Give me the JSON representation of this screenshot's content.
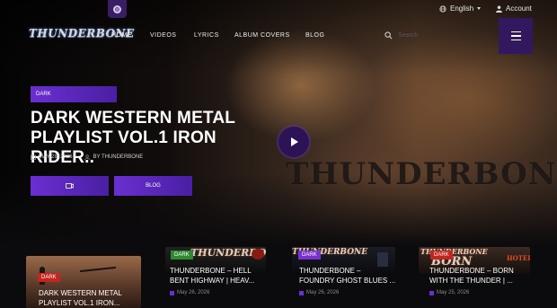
{
  "topbar": {
    "pill_icon": "instagram-icon",
    "language": "English",
    "account": "Account"
  },
  "nav": {
    "logo": "THUNDERBONE",
    "links": [
      "HOME",
      "VIDEOS",
      "LYRICS",
      "ALBUM COVERS",
      "BLOG"
    ],
    "search_placeholder": "Search"
  },
  "hero": {
    "tag": "DARK",
    "title_line1": "DARK WESTERN METAL",
    "title_line2": "PLAYLIST VOL.1 IRON RIDER..",
    "date": "MAY 28, 2026",
    "author": "BY THUNDERBONE",
    "button1_icon": "video-icon",
    "button2_label": "BLOG",
    "watermark": "THUNDERBONE"
  },
  "cards": [
    {
      "tag": "DARK",
      "title1": "DARK WESTERN METAL",
      "title2": "PLAYLIST VOL.1 IRON..."
    },
    {
      "tag": "DARK",
      "logo": "THUNDERBONE",
      "title1": "THUNDERBONE – HELL",
      "title2": "BENT HIGHWAY | HEAV...",
      "date": "May 26, 2026"
    },
    {
      "tag": "DARK",
      "logo": "THUNDERBONE",
      "title1": "THUNDERBONE –",
      "title2": "FOUNDRY GHOST BLUES ...",
      "date": "May 26, 2026"
    },
    {
      "tag": "DARK",
      "logo": "THUNDERBONE",
      "logo2": "BORN",
      "sign": "HOTEL",
      "title1": "THUNDERBONE – BORN",
      "title2": "WITH THE THUNDER | ...",
      "date": "May 25, 2026"
    }
  ],
  "colors": {
    "accent": "#6a2fd1",
    "accent_dark": "#32185e",
    "tag_green": "#2e8a2e",
    "tag_red": "#c2261f",
    "tag_purple": "#7a2fd1"
  }
}
